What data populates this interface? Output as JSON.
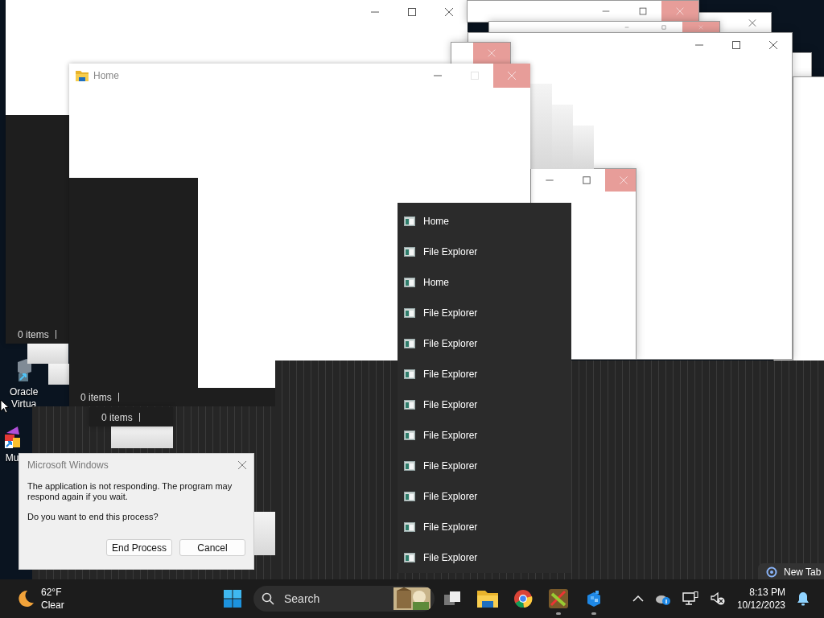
{
  "desktop_labels": [
    {
      "kind": "shortcut",
      "lines": [
        "Oracle",
        "Virtua"
      ]
    },
    {
      "kind": "shortcut",
      "lines": [
        "Mu"
      ]
    }
  ],
  "window_trail": [
    {
      "close_hovered": false
    },
    {
      "close_hovered": true
    },
    {
      "close_hovered": true
    },
    {
      "close_hovered": false
    },
    {
      "close_hovered": true
    },
    {
      "close_hovered": true
    }
  ],
  "explorer_windows": [
    {
      "status": "0 items",
      "close_hovered": false
    },
    {
      "title": "Home",
      "status": "0 items",
      "close_hovered": true
    },
    {
      "status": "0 items"
    }
  ],
  "jump_list": [
    {
      "label": "Home"
    },
    {
      "label": "File Explorer"
    },
    {
      "label": "Home"
    },
    {
      "label": "File Explorer"
    },
    {
      "label": "File Explorer"
    },
    {
      "label": "File Explorer"
    },
    {
      "label": "File Explorer"
    },
    {
      "label": "File Explorer"
    },
    {
      "label": "File Explorer"
    },
    {
      "label": "File Explorer"
    },
    {
      "label": "File Explorer"
    },
    {
      "label": "File Explorer"
    }
  ],
  "browser_tab": {
    "label": "New Tab"
  },
  "dialog": {
    "title": "Microsoft Windows",
    "message": "The application is not responding. The program may respond again if you wait.",
    "question": "Do you want to end this process?",
    "buttons": [
      "End Process",
      "Cancel"
    ]
  },
  "taskbar": {
    "weather": {
      "temperature": "62°F",
      "condition": "Clear"
    },
    "search": {
      "placeholder": "Search"
    },
    "apps": [
      {
        "kind": "taskview",
        "running": false
      },
      {
        "kind": "folder",
        "running": false
      },
      {
        "kind": "browser",
        "running": false
      },
      {
        "kind": "game",
        "running": true
      },
      {
        "kind": "cube",
        "running": true
      }
    ],
    "clock": {
      "time": "8:13 PM",
      "date": "10/12/2023"
    }
  }
}
